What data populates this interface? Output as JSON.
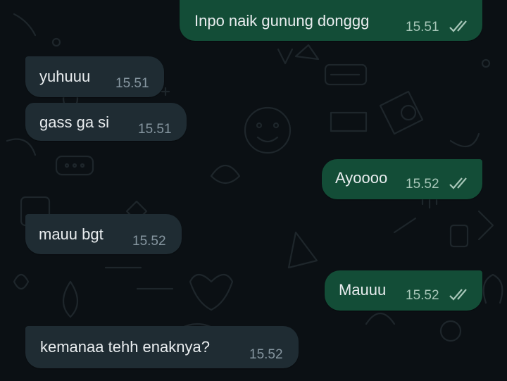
{
  "colors": {
    "background": "#0b1014",
    "incoming_bubble": "#1f2c33",
    "outgoing_bubble": "#134d37",
    "text": "#e9edef",
    "timestamp_incoming": "#8696a0",
    "timestamp_outgoing": "#a7c6b8",
    "read_ticks": "#a7c6b8"
  },
  "messages": [
    {
      "direction": "outgoing",
      "text": "Inpo naik gunung donggg",
      "time": "15.51",
      "status_icon": "double-check-icon"
    },
    {
      "direction": "incoming",
      "text": "yuhuuu",
      "time": "15.51"
    },
    {
      "direction": "incoming",
      "text": "gass ga si",
      "time": "15.51"
    },
    {
      "direction": "outgoing",
      "text": "Ayoooo",
      "time": "15.52",
      "status_icon": "double-check-icon"
    },
    {
      "direction": "incoming",
      "text": "mauu bgt",
      "time": "15.52"
    },
    {
      "direction": "outgoing",
      "text": "Mauuu",
      "time": "15.52",
      "status_icon": "double-check-icon"
    },
    {
      "direction": "incoming",
      "text": "kemanaa tehh enaknya?",
      "time": "15.52"
    }
  ]
}
